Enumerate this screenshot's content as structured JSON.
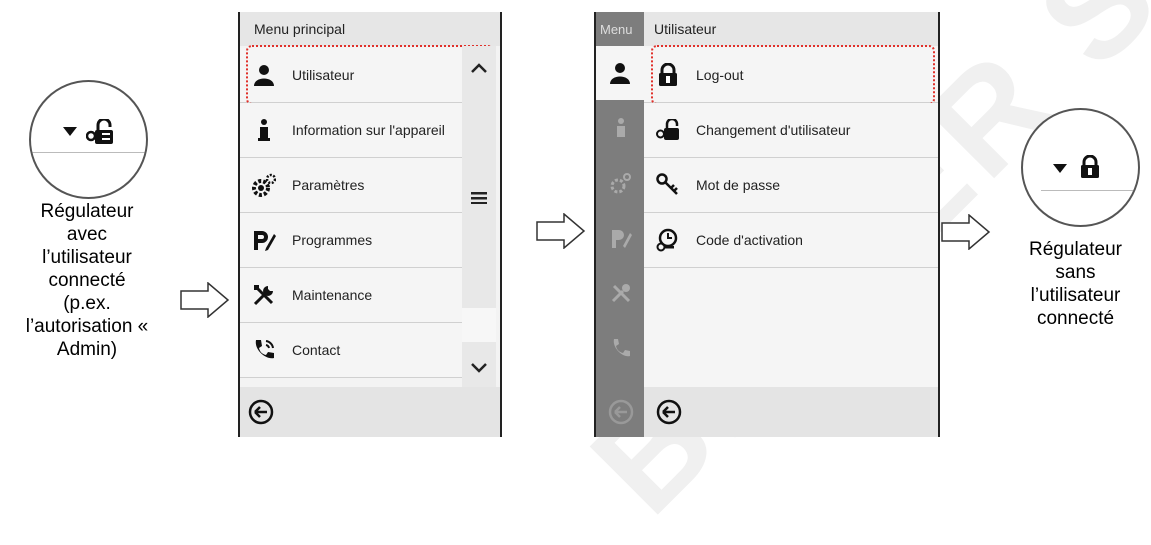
{
  "left_state": {
    "caption_lines": [
      "Régulateur",
      "avec",
      "l’utilisateur",
      "connecté",
      "(p.ex.",
      "l’autorisation «",
      "Admin)"
    ],
    "icon": "unlock-key-icon"
  },
  "main_menu": {
    "title": "Menu principal",
    "items": [
      {
        "label": "Utilisateur",
        "icon": "user-icon",
        "highlighted": true
      },
      {
        "label": "Information sur l'appareil",
        "icon": "info-icon"
      },
      {
        "label": "Paramètres",
        "icon": "gears-icon"
      },
      {
        "label": "Programmes",
        "icon": "program-icon"
      },
      {
        "label": "Maintenance",
        "icon": "tools-icon"
      },
      {
        "label": "Contact",
        "icon": "phone-icon"
      }
    ],
    "back_icon": "back-icon"
  },
  "user_menu": {
    "sidebar_label": "Menu",
    "title": "Utilisateur",
    "items": [
      {
        "label": "Log-out",
        "icon": "lock-icon",
        "highlighted": true
      },
      {
        "label": "Changement d'utilisateur",
        "icon": "unlock-key-icon"
      },
      {
        "label": "Mot de passe",
        "icon": "key-icon"
      },
      {
        "label": "Code d'activation",
        "icon": "activation-icon"
      }
    ]
  },
  "right_state": {
    "caption_lines": [
      "Régulateur",
      "sans",
      "l’utilisateur",
      "connecté"
    ],
    "icon": "lock-icon"
  },
  "watermark": "BINDER SA"
}
